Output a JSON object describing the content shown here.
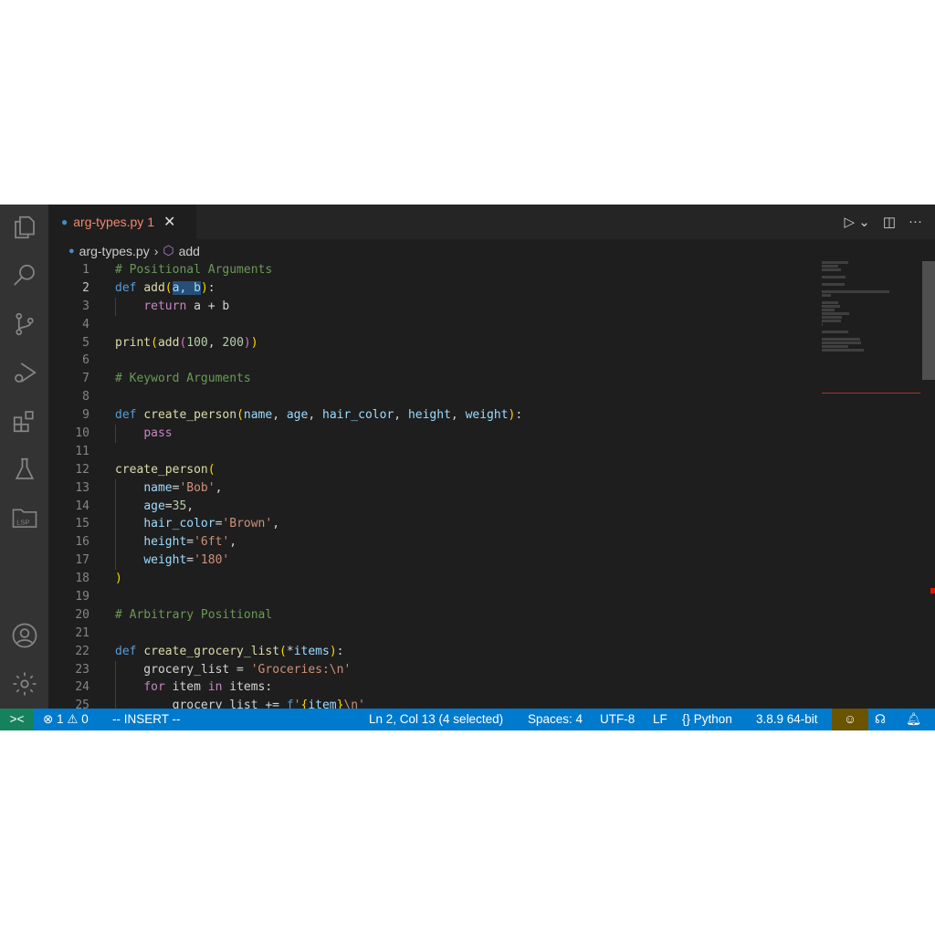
{
  "tab": {
    "filename": "arg-types.py",
    "problems": "1"
  },
  "breadcrumb": {
    "file": "arg-types.py",
    "symbol": "add"
  },
  "code": [
    [
      [
        "cm",
        "# Positional Arguments"
      ]
    ],
    [
      [
        "kw",
        "def "
      ],
      [
        "fn",
        "add"
      ],
      [
        "pa",
        "("
      ],
      [
        "sel",
        "a, b"
      ],
      [
        "pa",
        ")"
      ],
      [
        "pu",
        ":"
      ]
    ],
    [
      [
        "pu",
        "    "
      ],
      [
        "ct",
        "return"
      ],
      [
        "pu",
        " a + b"
      ]
    ],
    [],
    [
      [
        "fn",
        "print"
      ],
      [
        "pa",
        "("
      ],
      [
        "fn",
        "add"
      ],
      [
        "pb",
        "("
      ],
      [
        "nu",
        "100"
      ],
      [
        "pu",
        ", "
      ],
      [
        "nu",
        "200"
      ],
      [
        "pb",
        ")"
      ],
      [
        "pa",
        ")"
      ]
    ],
    [],
    [
      [
        "cm",
        "# Keyword Arguments"
      ]
    ],
    [],
    [
      [
        "kw",
        "def "
      ],
      [
        "fn",
        "create_person"
      ],
      [
        "pa",
        "("
      ],
      [
        "va",
        "name"
      ],
      [
        "pu",
        ", "
      ],
      [
        "va",
        "age"
      ],
      [
        "pu",
        ", "
      ],
      [
        "va",
        "hair_color"
      ],
      [
        "pu",
        ", "
      ],
      [
        "va",
        "height"
      ],
      [
        "pu",
        ", "
      ],
      [
        "va",
        "weight"
      ],
      [
        "pa",
        ")"
      ],
      [
        "pu",
        ":"
      ]
    ],
    [
      [
        "pu",
        "    "
      ],
      [
        "ct",
        "pass"
      ]
    ],
    [],
    [
      [
        "fn",
        "create_person"
      ],
      [
        "pa",
        "("
      ]
    ],
    [
      [
        "pu",
        "    "
      ],
      [
        "va",
        "name"
      ],
      [
        "pu",
        "="
      ],
      [
        "st",
        "'Bob'"
      ],
      [
        "pu",
        ","
      ]
    ],
    [
      [
        "pu",
        "    "
      ],
      [
        "va",
        "age"
      ],
      [
        "pu",
        "="
      ],
      [
        "nu",
        "35"
      ],
      [
        "pu",
        ","
      ]
    ],
    [
      [
        "pu",
        "    "
      ],
      [
        "va",
        "hair_color"
      ],
      [
        "pu",
        "="
      ],
      [
        "st",
        "'Brown'"
      ],
      [
        "pu",
        ","
      ]
    ],
    [
      [
        "pu",
        "    "
      ],
      [
        "va",
        "height"
      ],
      [
        "pu",
        "="
      ],
      [
        "st",
        "'6ft'"
      ],
      [
        "pu",
        ","
      ]
    ],
    [
      [
        "pu",
        "    "
      ],
      [
        "va",
        "weight"
      ],
      [
        "pu",
        "="
      ],
      [
        "st",
        "'180'"
      ]
    ],
    [
      [
        "pa",
        ")"
      ]
    ],
    [],
    [
      [
        "cm",
        "# Arbitrary Positional"
      ]
    ],
    [],
    [
      [
        "kw",
        "def "
      ],
      [
        "fn",
        "create_grocery_list"
      ],
      [
        "pa",
        "("
      ],
      [
        "pu",
        "*"
      ],
      [
        "va",
        "items"
      ],
      [
        "pa",
        ")"
      ],
      [
        "pu",
        ":"
      ]
    ],
    [
      [
        "pu",
        "    grocery_list = "
      ],
      [
        "st",
        "'Groceries:\\n'"
      ]
    ],
    [
      [
        "pu",
        "    "
      ],
      [
        "ct",
        "for"
      ],
      [
        "pu",
        " item "
      ],
      [
        "ct",
        "in"
      ],
      [
        "pu",
        " items:"
      ]
    ],
    [
      [
        "pu",
        "        grocery_list += "
      ],
      [
        "kw",
        "f"
      ],
      [
        "st",
        "'"
      ],
      [
        "pa",
        "{"
      ],
      [
        "va",
        "item"
      ],
      [
        "pa",
        "}"
      ],
      [
        "st",
        "\\n'"
      ]
    ]
  ],
  "current_line": 2,
  "status": {
    "errors": "1",
    "warnings": "0",
    "mode": "-- INSERT --",
    "position": "Ln 2, Col 13 (4 selected)",
    "spaces": "Spaces: 4",
    "encoding": "UTF-8",
    "eol": "LF",
    "language": "Python",
    "interpreter": "3.8.9 64-bit"
  }
}
